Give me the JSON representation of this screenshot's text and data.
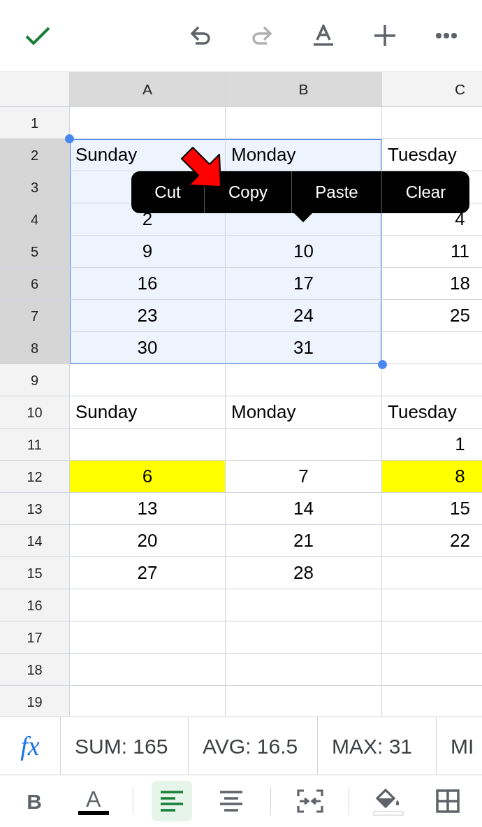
{
  "top_toolbar": [
    {
      "kind": "confirm"
    },
    {
      "kind": "undo",
      "disabled": false
    },
    {
      "kind": "redo",
      "disabled": true
    },
    {
      "kind": "text-format"
    },
    {
      "kind": "insert"
    },
    {
      "kind": "more"
    }
  ],
  "sheet": {
    "columns": [
      {
        "label": "A",
        "selected": true
      },
      {
        "label": "B",
        "selected": true
      },
      {
        "label": "C",
        "selected": false
      }
    ],
    "rows": [
      {
        "label": "1",
        "selected": false,
        "cells": [
          {
            "kind": "empty"
          },
          {
            "kind": "empty"
          },
          {
            "kind": "empty"
          }
        ]
      },
      {
        "label": "2",
        "selected": true,
        "cells": [
          {
            "kind": "text",
            "text": "Sunday"
          },
          {
            "kind": "text",
            "text": "Monday"
          },
          {
            "kind": "text",
            "text": "Tuesday"
          }
        ]
      },
      {
        "label": "3",
        "selected": true,
        "cells": [
          {
            "kind": "empty"
          },
          {
            "kind": "empty"
          },
          {
            "kind": "empty"
          }
        ]
      },
      {
        "label": "4",
        "selected": true,
        "cells": [
          {
            "kind": "number",
            "text": "2"
          },
          {
            "kind": "empty"
          },
          {
            "kind": "number",
            "text": "4"
          }
        ]
      },
      {
        "label": "5",
        "selected": true,
        "cells": [
          {
            "kind": "number",
            "text": "9"
          },
          {
            "kind": "number",
            "text": "10"
          },
          {
            "kind": "number",
            "text": "11"
          }
        ]
      },
      {
        "label": "6",
        "selected": true,
        "cells": [
          {
            "kind": "number",
            "text": "16"
          },
          {
            "kind": "number",
            "text": "17"
          },
          {
            "kind": "number",
            "text": "18"
          }
        ]
      },
      {
        "label": "7",
        "selected": true,
        "cells": [
          {
            "kind": "number",
            "text": "23"
          },
          {
            "kind": "number",
            "text": "24"
          },
          {
            "kind": "number",
            "text": "25"
          }
        ]
      },
      {
        "label": "8",
        "selected": true,
        "cells": [
          {
            "kind": "number",
            "text": "30"
          },
          {
            "kind": "number",
            "text": "31"
          },
          {
            "kind": "empty"
          }
        ]
      },
      {
        "label": "9",
        "selected": false,
        "cells": [
          {
            "kind": "empty"
          },
          {
            "kind": "empty"
          },
          {
            "kind": "empty"
          }
        ]
      },
      {
        "label": "10",
        "selected": false,
        "cells": [
          {
            "kind": "text",
            "text": "Sunday"
          },
          {
            "kind": "text",
            "text": "Monday"
          },
          {
            "kind": "text",
            "text": "Tuesday"
          }
        ]
      },
      {
        "label": "11",
        "selected": false,
        "cells": [
          {
            "kind": "empty"
          },
          {
            "kind": "empty"
          },
          {
            "kind": "number",
            "text": "1"
          }
        ]
      },
      {
        "label": "12",
        "selected": false,
        "cells": [
          {
            "kind": "number",
            "text": "6",
            "highlighted": true
          },
          {
            "kind": "number",
            "text": "7"
          },
          {
            "kind": "number",
            "text": "8",
            "highlighted": true
          }
        ]
      },
      {
        "label": "13",
        "selected": false,
        "cells": [
          {
            "kind": "number",
            "text": "13"
          },
          {
            "kind": "number",
            "text": "14"
          },
          {
            "kind": "number",
            "text": "15"
          }
        ]
      },
      {
        "label": "14",
        "selected": false,
        "cells": [
          {
            "kind": "number",
            "text": "20"
          },
          {
            "kind": "number",
            "text": "21"
          },
          {
            "kind": "number",
            "text": "22"
          }
        ]
      },
      {
        "label": "15",
        "selected": false,
        "cells": [
          {
            "kind": "number",
            "text": "27"
          },
          {
            "kind": "number",
            "text": "28"
          },
          {
            "kind": "empty"
          }
        ]
      },
      {
        "label": "16",
        "selected": false,
        "cells": [
          {
            "kind": "empty"
          },
          {
            "kind": "empty"
          },
          {
            "kind": "empty"
          }
        ]
      },
      {
        "label": "17",
        "selected": false,
        "cells": [
          {
            "kind": "empty"
          },
          {
            "kind": "empty"
          },
          {
            "kind": "empty"
          }
        ]
      },
      {
        "label": "18",
        "selected": false,
        "cells": [
          {
            "kind": "empty"
          },
          {
            "kind": "empty"
          },
          {
            "kind": "empty"
          }
        ]
      },
      {
        "label": "19",
        "selected": false,
        "cells": [
          {
            "kind": "empty"
          },
          {
            "kind": "empty"
          },
          {
            "kind": "empty"
          }
        ]
      }
    ]
  },
  "context_menu": [
    "Cut",
    "Copy",
    "Paste",
    "Clear"
  ],
  "formula_bar": {
    "function_label": "fx",
    "stats": [
      "SUM: 165",
      "AVG: 16.5",
      "MAX: 31",
      "MI"
    ]
  },
  "format_toolbar": [
    {
      "kind": "bold",
      "text": "B",
      "selected": false
    },
    {
      "kind": "text-color",
      "text": "A",
      "selected": false
    },
    {
      "kind": "divider"
    },
    {
      "kind": "align-left",
      "selected": true
    },
    {
      "kind": "align-center",
      "selected": false
    },
    {
      "kind": "divider"
    },
    {
      "kind": "merge",
      "selected": false
    },
    {
      "kind": "divider"
    },
    {
      "kind": "fill-color",
      "selected": false
    },
    {
      "kind": "borders",
      "selected": false
    }
  ]
}
